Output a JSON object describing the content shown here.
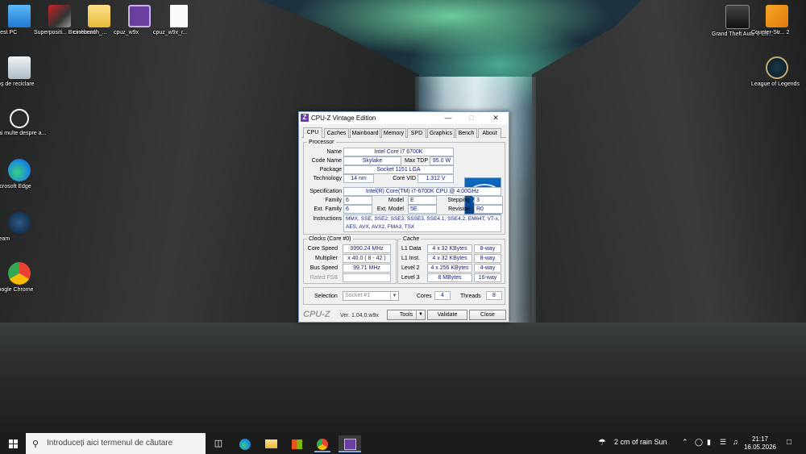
{
  "desktop": {
    "icons_left": [
      {
        "label": "Acest PC",
        "icon": "this-pc-icon"
      },
      {
        "label": "Coș de reciclare",
        "icon": "recycle-bin-icon"
      },
      {
        "label": "Mai multe despre a...",
        "icon": "learn-more-icon"
      },
      {
        "label": "Microsoft Edge",
        "icon": "edge-icon"
      },
      {
        "label": "Steam",
        "icon": "steam-icon"
      },
      {
        "label": "Google Chrome",
        "icon": "chrome-icon"
      }
    ],
    "icons_top": [
      {
        "label": "Superpositi... Benchmark",
        "icon": "superposition-icon"
      },
      {
        "label": "cinebench_...",
        "icon": "folder-icon"
      },
      {
        "label": "cpuz_w9x",
        "icon": "cpuz-icon"
      },
      {
        "label": "cpuz_w9x_r...",
        "icon": "file-icon"
      }
    ],
    "icons_right": [
      {
        "label": "Grand Theft Auto V En...",
        "icon": "gta-icon"
      },
      {
        "label": "Counter-Str... 2",
        "icon": "cs2-icon"
      },
      {
        "label": "League of Legends",
        "icon": "lol-icon"
      }
    ]
  },
  "cpuz": {
    "title": "CPU-Z Vintage Edition",
    "app_icon_letter": "Z",
    "tabs": [
      "CPU",
      "Caches",
      "Mainboard",
      "Memory",
      "SPD",
      "Graphics",
      "Bench",
      "About"
    ],
    "active_tab": "CPU",
    "processor": {
      "group_label": "Processor",
      "name_label": "Name",
      "name": "Intel Core i7 6700K",
      "codename_label": "Code Name",
      "codename": "Skylake",
      "maxtdp_label": "Max TDP",
      "maxtdp": "95.0 W",
      "package_label": "Package",
      "package": "Socket 1151 LGA",
      "technology_label": "Technology",
      "technology": "14 nm",
      "corevid_label": "Core VID",
      "corevid": "1.312 V",
      "spec_label": "Specification",
      "spec": "Intel(R) Core(TM) i7-6700K CPU @ 4.00GHz",
      "family_label": "Family",
      "family": "6",
      "model_label": "Model",
      "model": "E",
      "stepping_label": "Stepping",
      "stepping": "3",
      "extfamily_label": "Ext. Family",
      "extfamily": "6",
      "extmodel_label": "Ext. Model",
      "extmodel": "5E",
      "revision_label": "Revision",
      "revision": "R0",
      "instructions_label": "Instructions",
      "instructions_line1": "MMX, SSE, SSE2, SSE3, SSSE3, SSE4.1, SSE4.2, EM64T, VT-x,",
      "instructions_line2": "AES, AVX, AVX2, FMA3, TSX",
      "badge_brand": "intel",
      "badge_line1": "CORE i7",
      "badge_line2": "inside"
    },
    "clocks": {
      "group_label": "Clocks (Core #0)",
      "corespeed_label": "Core Speed",
      "corespeed": "3990.24 MHz",
      "multiplier_label": "Multiplier",
      "multiplier": "x 40.0 ( 8 - 42 )",
      "busspeed_label": "Bus Speed",
      "busspeed": "99.71 MHz",
      "ratedfsb_label": "Rated FSB",
      "ratedfsb": ""
    },
    "cache": {
      "group_label": "Cache",
      "l1data_label": "L1 Data",
      "l1data": "4 x 32 KBytes",
      "l1data_way": "8-way",
      "l1inst_label": "L1 Inst.",
      "l1inst": "4 x 32 KBytes",
      "l1inst_way": "8-way",
      "l2_label": "Level 2",
      "l2": "4 x 256 KBytes",
      "l2_way": "4-way",
      "l3_label": "Level 3",
      "l3": "8 MBytes",
      "l3_way": "16-way"
    },
    "selection": {
      "label": "Selection",
      "value": "Socket #1",
      "cores_label": "Cores",
      "cores": "4",
      "threads_label": "Threads",
      "threads": "8"
    },
    "footer": {
      "logo": "CPU-Z",
      "version": "Ver. 1.04.0.w9x",
      "tools_label": "Tools",
      "validate_label": "Validate",
      "close_label": "Close"
    }
  },
  "taskbar": {
    "search_placeholder": "Introduceți aici termenul de căutare",
    "weather": "2 cm of rain Sun",
    "time": "21:17",
    "date": "16.05.2026"
  }
}
